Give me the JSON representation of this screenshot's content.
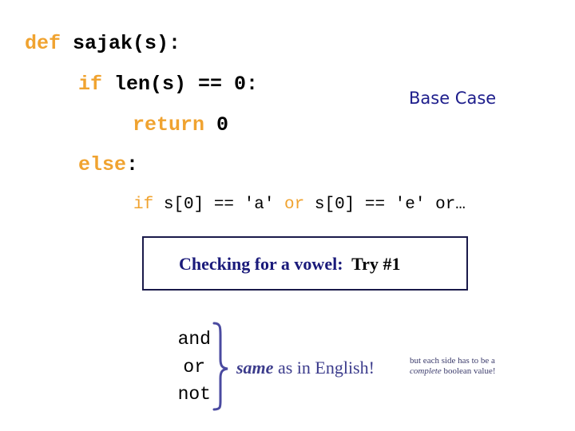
{
  "code": {
    "line1": {
      "keyword": "def",
      "rest": " sajak(s):"
    },
    "line2": {
      "keyword": "if",
      "rest": " len(s) == 0:"
    },
    "line3": {
      "keyword": "return",
      "rest": " 0"
    },
    "line4": {
      "keyword": "else",
      "rest": ":"
    },
    "line5": {
      "kw1": "if",
      "part1": " s[0] == 'a' ",
      "kw2": "or",
      "part2": " s[0] == 'e' or…"
    }
  },
  "annotations": {
    "base_case": "Base Case",
    "vowel_box": {
      "label": "Checking for a vowel:",
      "try": "  Try #1"
    },
    "operators": [
      "and",
      "or",
      "not"
    ],
    "same_as": {
      "emphasis": "same",
      "rest": " as in English!"
    },
    "note": {
      "line1": "but each side has to be a",
      "emphasis": "complete",
      "line2_rest": " boolean value!"
    }
  },
  "colors": {
    "keyword": "#f0a330",
    "navy_text": "#1e1e8c",
    "brace": "#4a4aa0",
    "box_border": "#1a1a4a"
  }
}
